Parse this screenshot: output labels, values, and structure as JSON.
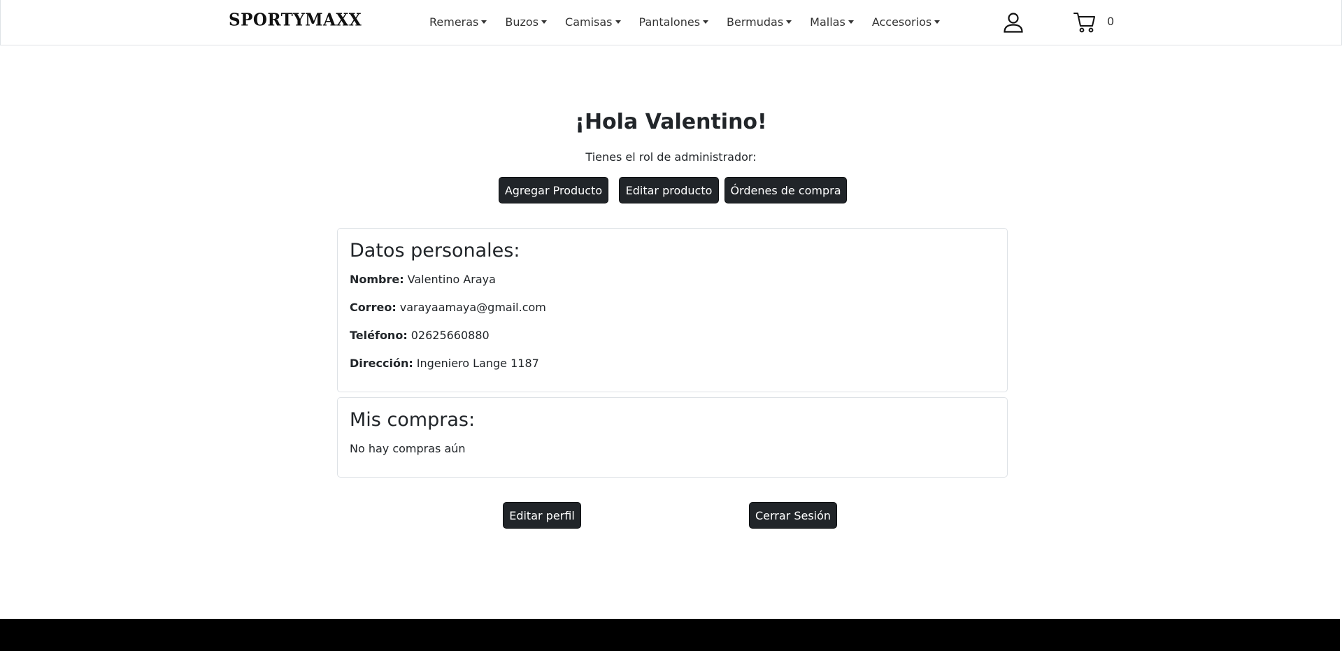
{
  "header": {
    "brand": "SPORTYMAXX",
    "nav_items": [
      {
        "label": "Remeras"
      },
      {
        "label": "Buzos"
      },
      {
        "label": "Camisas"
      },
      {
        "label": "Pantalones"
      },
      {
        "label": "Bermudas"
      },
      {
        "label": "Mallas"
      },
      {
        "label": "Accesorios"
      }
    ],
    "user_icon": "user-icon",
    "cart_icon": "cart-icon",
    "cart_count": "0"
  },
  "main": {
    "greeting": "¡Hola Valentino!",
    "role_text": "Tienes el rol de administrador:",
    "admin_buttons": {
      "add_product": "Agregar Producto",
      "edit_product": "Editar producto",
      "orders": "Órdenes de compra"
    },
    "personal": {
      "title": "Datos personales:",
      "name_label": "Nombre:",
      "name_value": "Valentino Araya",
      "email_label": "Correo:",
      "email_value": "varayaamaya@gmail.com",
      "phone_label": "Teléfono:",
      "phone_value": "02625660880",
      "address_label": "Dirección:",
      "address_value": "Ingeniero Lange 1187"
    },
    "purchases": {
      "title": "Mis compras:",
      "empty_text": "No hay compras aún"
    },
    "edit_profile_label": "Editar perfil",
    "logout_label": "Cerrar Sesión"
  },
  "colors": {
    "button_bg": "#212529",
    "button_text": "#ffffff",
    "card_border": "#dee2e6",
    "footer_bg": "#000000"
  }
}
